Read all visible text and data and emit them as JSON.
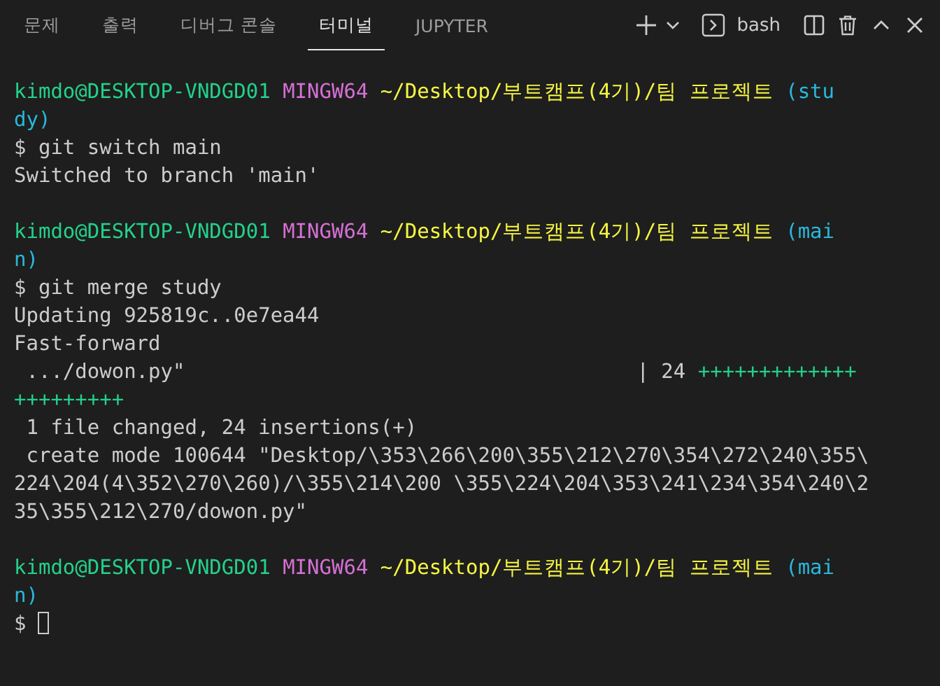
{
  "tabs": [
    {
      "label": "문제",
      "selected": false
    },
    {
      "label": "출력",
      "selected": false
    },
    {
      "label": "디버그 콘솔",
      "selected": false
    },
    {
      "label": "터미널",
      "selected": true
    },
    {
      "label": "JUPYTER",
      "selected": false
    }
  ],
  "toolbar": {
    "shell": "bash"
  },
  "terminal": {
    "blocks": [
      {
        "lines": [
          {
            "segments": [
              {
                "kind": "user",
                "text": "kimdo@DESKTOP-VNDGD01 "
              },
              {
                "kind": "system",
                "text": "MINGW64 "
              },
              {
                "kind": "path",
                "text": "~/Desktop/부트캠프(4기)/팀 프로젝트 "
              },
              {
                "kind": "branch",
                "text": "(stu"
              }
            ]
          },
          {
            "segments": [
              {
                "kind": "branch",
                "text": "dy)"
              }
            ]
          },
          {
            "segments": [
              {
                "kind": "plain",
                "text": "$ git switch main"
              }
            ]
          },
          {
            "segments": [
              {
                "kind": "plain",
                "text": "Switched to branch 'main'"
              }
            ]
          }
        ]
      },
      {
        "lines": [
          {
            "segments": [
              {
                "kind": "user",
                "text": "kimdo@DESKTOP-VNDGD01 "
              },
              {
                "kind": "system",
                "text": "MINGW64 "
              },
              {
                "kind": "path",
                "text": "~/Desktop/부트캠프(4기)/팀 프로젝트 "
              },
              {
                "kind": "branch",
                "text": "(mai"
              }
            ]
          },
          {
            "segments": [
              {
                "kind": "branch",
                "text": "n)"
              }
            ]
          },
          {
            "segments": [
              {
                "kind": "plain",
                "text": "$ git merge study"
              }
            ]
          },
          {
            "segments": [
              {
                "kind": "plain",
                "text": "Updating 925819c..0e7ea44"
              }
            ]
          },
          {
            "segments": [
              {
                "kind": "plain",
                "text": "Fast-forward"
              }
            ]
          },
          {
            "segments": [
              {
                "kind": "plain",
                "text": " .../dowon.py\"                                     | 24 "
              },
              {
                "kind": "plus",
                "text": "+++++++++++++"
              }
            ]
          },
          {
            "segments": [
              {
                "kind": "plus",
                "text": "+++++++++"
              }
            ]
          },
          {
            "segments": [
              {
                "kind": "plain",
                "text": " 1 file changed, 24 insertions(+)"
              }
            ]
          },
          {
            "segments": [
              {
                "kind": "plain",
                "text": " create mode 100644 \"Desktop/\\353\\266\\200\\355\\212\\270\\354\\272\\240\\355\\"
              }
            ]
          },
          {
            "segments": [
              {
                "kind": "plain",
                "text": "224\\204(4\\352\\270\\260)/\\355\\214\\200 \\355\\224\\204\\353\\241\\234\\354\\240\\2"
              }
            ]
          },
          {
            "segments": [
              {
                "kind": "plain",
                "text": "35\\355\\212\\270/dowon.py\""
              }
            ]
          }
        ]
      },
      {
        "lines": [
          {
            "segments": [
              {
                "kind": "user",
                "text": "kimdo@DESKTOP-VNDGD01 "
              },
              {
                "kind": "system",
                "text": "MINGW64 "
              },
              {
                "kind": "path",
                "text": "~/Desktop/부트캠프(4기)/팀 프로젝트 "
              },
              {
                "kind": "branch",
                "text": "(mai"
              }
            ]
          },
          {
            "segments": [
              {
                "kind": "branch",
                "text": "n)"
              }
            ]
          },
          {
            "segments": [
              {
                "kind": "plain",
                "text": "$ "
              }
            ],
            "cursor": true
          }
        ]
      }
    ]
  }
}
